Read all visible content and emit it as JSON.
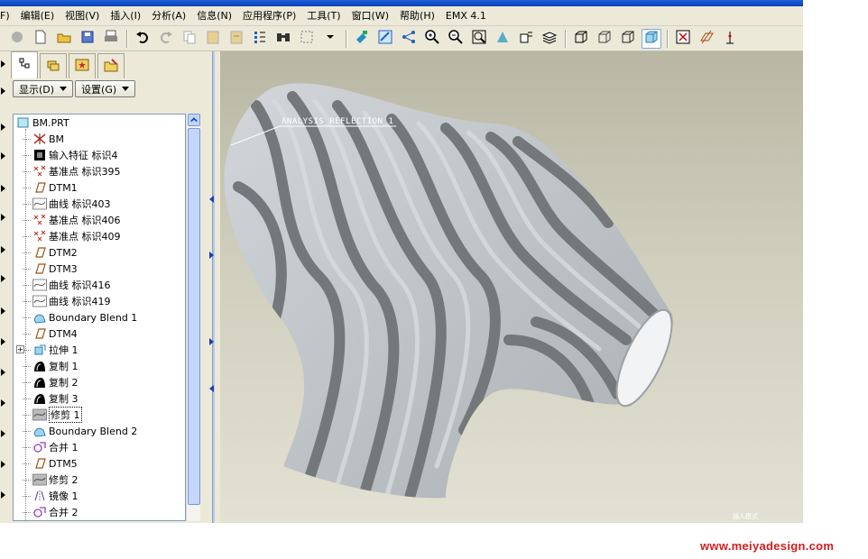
{
  "menubar": {
    "items": [
      "F)",
      "编辑(E)",
      "视图(V)",
      "插入(I)",
      "分析(A)",
      "信息(N)",
      "应用程序(P)",
      "工具(T)",
      "窗口(W)",
      "帮助(H)",
      "EMX 4.1"
    ]
  },
  "toolbar": {
    "groups": [
      [
        "open-session-icon",
        "new-file-icon",
        "open-folder-icon",
        "save-icon",
        "print-icon"
      ],
      [
        "undo-icon",
        "redo-icon",
        "copy-icon",
        "paste-icon",
        "paste-special-icon",
        "regenerate-icon",
        "find-icon",
        "select-box-icon",
        "dropdown-arrow-icon"
      ],
      [
        "repaint-icon",
        "spin-center-icon",
        "orient-icon",
        "zoom-in-icon",
        "zoom-out-icon",
        "refit-icon",
        "reorient-icon",
        "saved-views-icon",
        "layers-icon"
      ],
      [
        "wireframe-icon",
        "hidden-line-icon",
        "no-hidden-icon",
        "shading-icon"
      ],
      [
        "datum-planes-icon",
        "datum-axes-icon",
        "datum-points-icon"
      ]
    ]
  },
  "navigator": {
    "tabs": [
      "model-tree-tab-icon",
      "layers-tab-icon",
      "favorites-tab-icon",
      "folder-browser-tab-icon"
    ],
    "show_button": "显示(D)",
    "settings_button": "设置(G)",
    "tree_root": "BM.PRT",
    "tree_items": [
      {
        "icon": "csys-icon",
        "label": "BM"
      },
      {
        "icon": "import-feature-icon",
        "label": "输入特征 标识4"
      },
      {
        "icon": "datum-point-icon",
        "label": "基准点 标识395"
      },
      {
        "icon": "datum-plane-icon",
        "label": "DTM1"
      },
      {
        "icon": "curve-icon",
        "label": "曲线 标识403"
      },
      {
        "icon": "datum-point-icon",
        "label": "基准点 标识406"
      },
      {
        "icon": "datum-point-icon",
        "label": "基准点 标识409"
      },
      {
        "icon": "datum-plane-icon",
        "label": "DTM2"
      },
      {
        "icon": "datum-plane-icon",
        "label": "DTM3"
      },
      {
        "icon": "curve-icon",
        "label": "曲线 标识416"
      },
      {
        "icon": "curve-icon",
        "label": "曲线 标识419"
      },
      {
        "icon": "boundary-blend-icon",
        "label": "Boundary Blend 1"
      },
      {
        "icon": "datum-plane-icon",
        "label": "DTM4"
      },
      {
        "icon": "extrude-icon",
        "label": "拉伸 1",
        "expandable": true
      },
      {
        "icon": "copy-surface-icon",
        "label": "复制 1"
      },
      {
        "icon": "copy-surface-icon",
        "label": "复制 2"
      },
      {
        "icon": "copy-surface-icon",
        "label": "复制 3"
      },
      {
        "icon": "trim-icon",
        "label": "修剪 1",
        "highlight": true
      },
      {
        "icon": "boundary-blend-icon",
        "label": "Boundary Blend 2"
      },
      {
        "icon": "merge-icon",
        "label": "合并 1"
      },
      {
        "icon": "datum-plane-icon",
        "label": "DTM5"
      },
      {
        "icon": "trim-icon",
        "label": "修剪 2"
      },
      {
        "icon": "mirror-icon",
        "label": "镜像 1"
      },
      {
        "icon": "merge-icon",
        "label": "合并 2"
      }
    ]
  },
  "viewport": {
    "analysis_label": "ANALYSIS_REFLECTION_1",
    "corner_label": "插入模式"
  },
  "watermark": "www.meiyadesign.com",
  "colors": {
    "viewport_top": "#b9b7a4",
    "viewport_bottom": "#e3e1d3",
    "stripe_light": "#c8ccd0",
    "stripe_dark": "#737779",
    "watermark": "#d81c1c"
  }
}
